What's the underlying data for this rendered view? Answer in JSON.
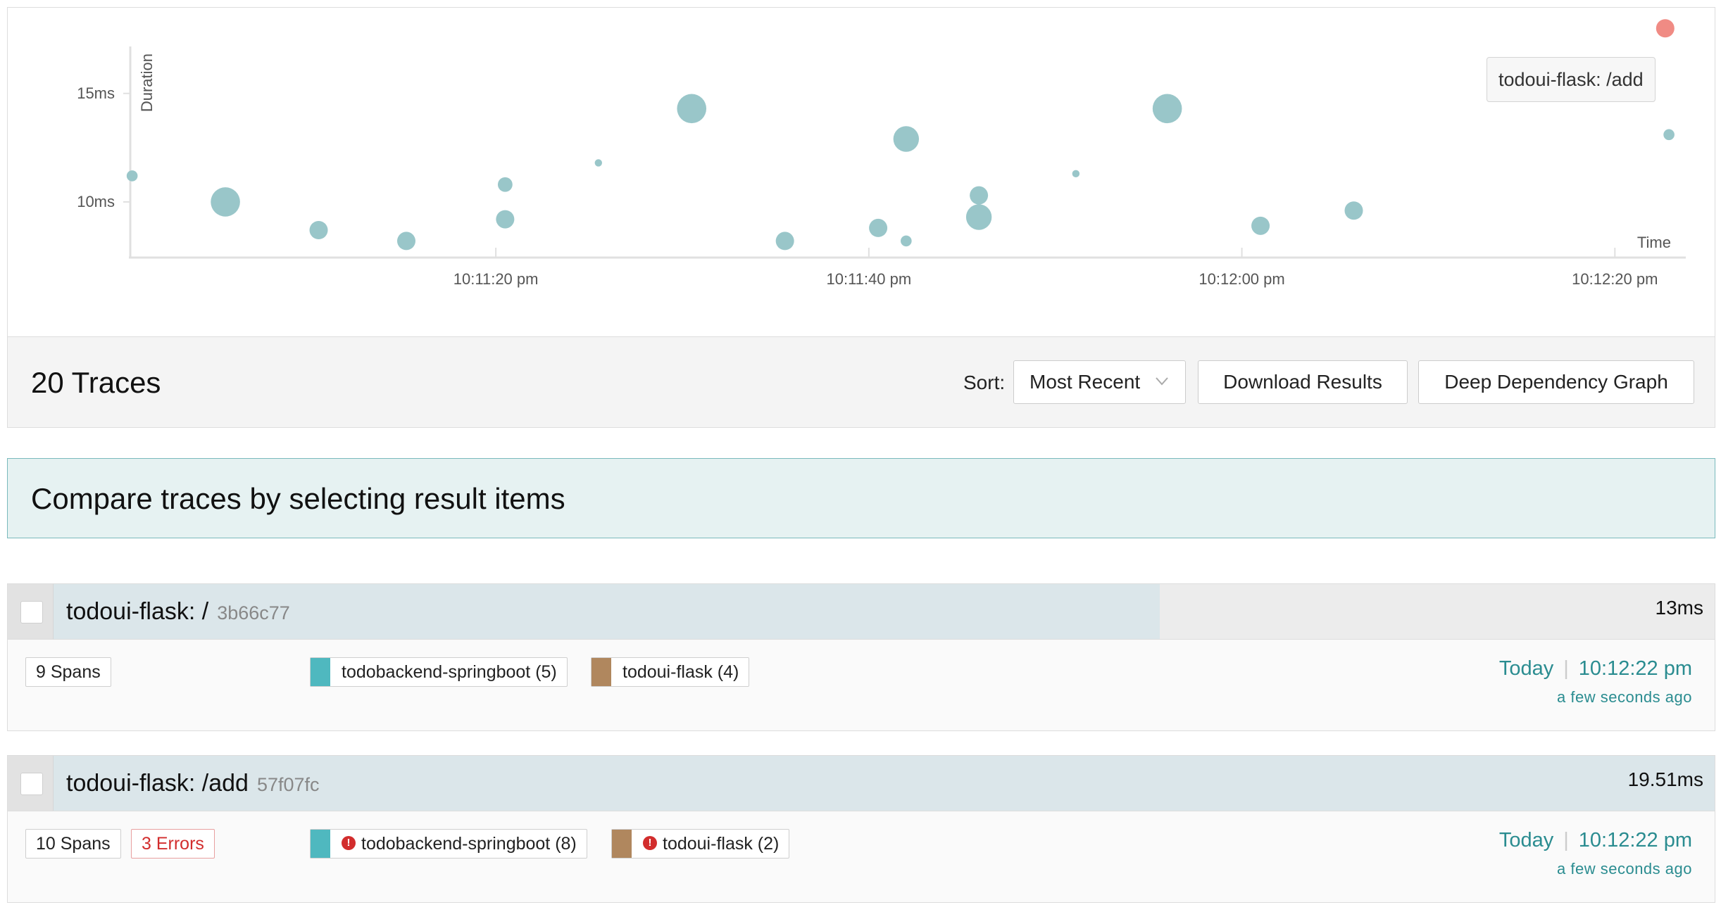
{
  "chart": {
    "y_axis_label": "Duration",
    "x_axis_label": "Time",
    "y_ticks": [
      "15ms",
      "10ms"
    ],
    "x_ticks": [
      "10:11:20 pm",
      "10:11:40 pm",
      "10:12:00 pm",
      "10:12:20 pm"
    ],
    "tooltip": "todoui-flask: /add",
    "point_color": "#99c6c9",
    "highlight_color": "#f08b84"
  },
  "chart_data": {
    "type": "scatter",
    "xlabel": "Time",
    "ylabel": "Duration",
    "x_unit": "seconds after 10:11:00 pm",
    "xlim": [
      0.4,
      83.5
    ],
    "ylim": [
      7.5,
      18.3
    ],
    "points": [
      {
        "x": 0.5,
        "y": 11.2,
        "size": 3
      },
      {
        "x": 5.5,
        "y": 10.0,
        "size": 8
      },
      {
        "x": 10.5,
        "y": 8.7,
        "size": 5
      },
      {
        "x": 15.2,
        "y": 8.2,
        "size": 5
      },
      {
        "x": 20.5,
        "y": 9.2,
        "size": 5
      },
      {
        "x": 20.5,
        "y": 10.8,
        "size": 4
      },
      {
        "x": 25.5,
        "y": 11.8,
        "size": 2
      },
      {
        "x": 30.5,
        "y": 14.3,
        "size": 8
      },
      {
        "x": 35.5,
        "y": 8.2,
        "size": 5
      },
      {
        "x": 40.5,
        "y": 8.8,
        "size": 5
      },
      {
        "x": 42.0,
        "y": 8.2,
        "size": 3
      },
      {
        "x": 42.0,
        "y": 12.9,
        "size": 7
      },
      {
        "x": 45.9,
        "y": 9.3,
        "size": 7
      },
      {
        "x": 45.9,
        "y": 10.3,
        "size": 5
      },
      {
        "x": 51.1,
        "y": 11.3,
        "size": 2
      },
      {
        "x": 56.0,
        "y": 14.3,
        "size": 8
      },
      {
        "x": 61.0,
        "y": 8.9,
        "size": 5
      },
      {
        "x": 66.0,
        "y": 9.6,
        "size": 5
      },
      {
        "x": 82.9,
        "y": 13.1,
        "size": 3
      },
      {
        "x": 82.7,
        "y": 18.0,
        "size": 5,
        "highlight": true
      }
    ]
  },
  "results": {
    "count_label": "20 Traces",
    "sort_label": "Sort:",
    "sort_value": "Most Recent",
    "download_label": "Download Results",
    "ddg_label": "Deep Dependency Graph"
  },
  "compare": {
    "text": "Compare traces by selecting result items"
  },
  "traces": [
    {
      "name": "todoui-flask: /",
      "id": "3b66c77",
      "duration": "13ms",
      "duration_fraction": 0.675,
      "spans": "9 Spans",
      "services": [
        {
          "label": "todobackend-springboot (5)",
          "color": "#4fb8bf",
          "error": false
        },
        {
          "label": "todoui-flask (4)",
          "color": "#b0875e",
          "error": false
        }
      ],
      "day": "Today",
      "time": "10:12:22 pm",
      "ago": "a few seconds ago"
    },
    {
      "name": "todoui-flask: /add",
      "id": "57f07fc",
      "duration": "19.51ms",
      "duration_fraction": 1.0,
      "spans": "10 Spans",
      "errors": "3 Errors",
      "services": [
        {
          "label": "todobackend-springboot (8)",
          "color": "#4fb8bf",
          "error": true
        },
        {
          "label": "todoui-flask (2)",
          "color": "#b0875e",
          "error": true
        }
      ],
      "day": "Today",
      "time": "10:12:22 pm",
      "ago": "a few seconds ago"
    }
  ]
}
